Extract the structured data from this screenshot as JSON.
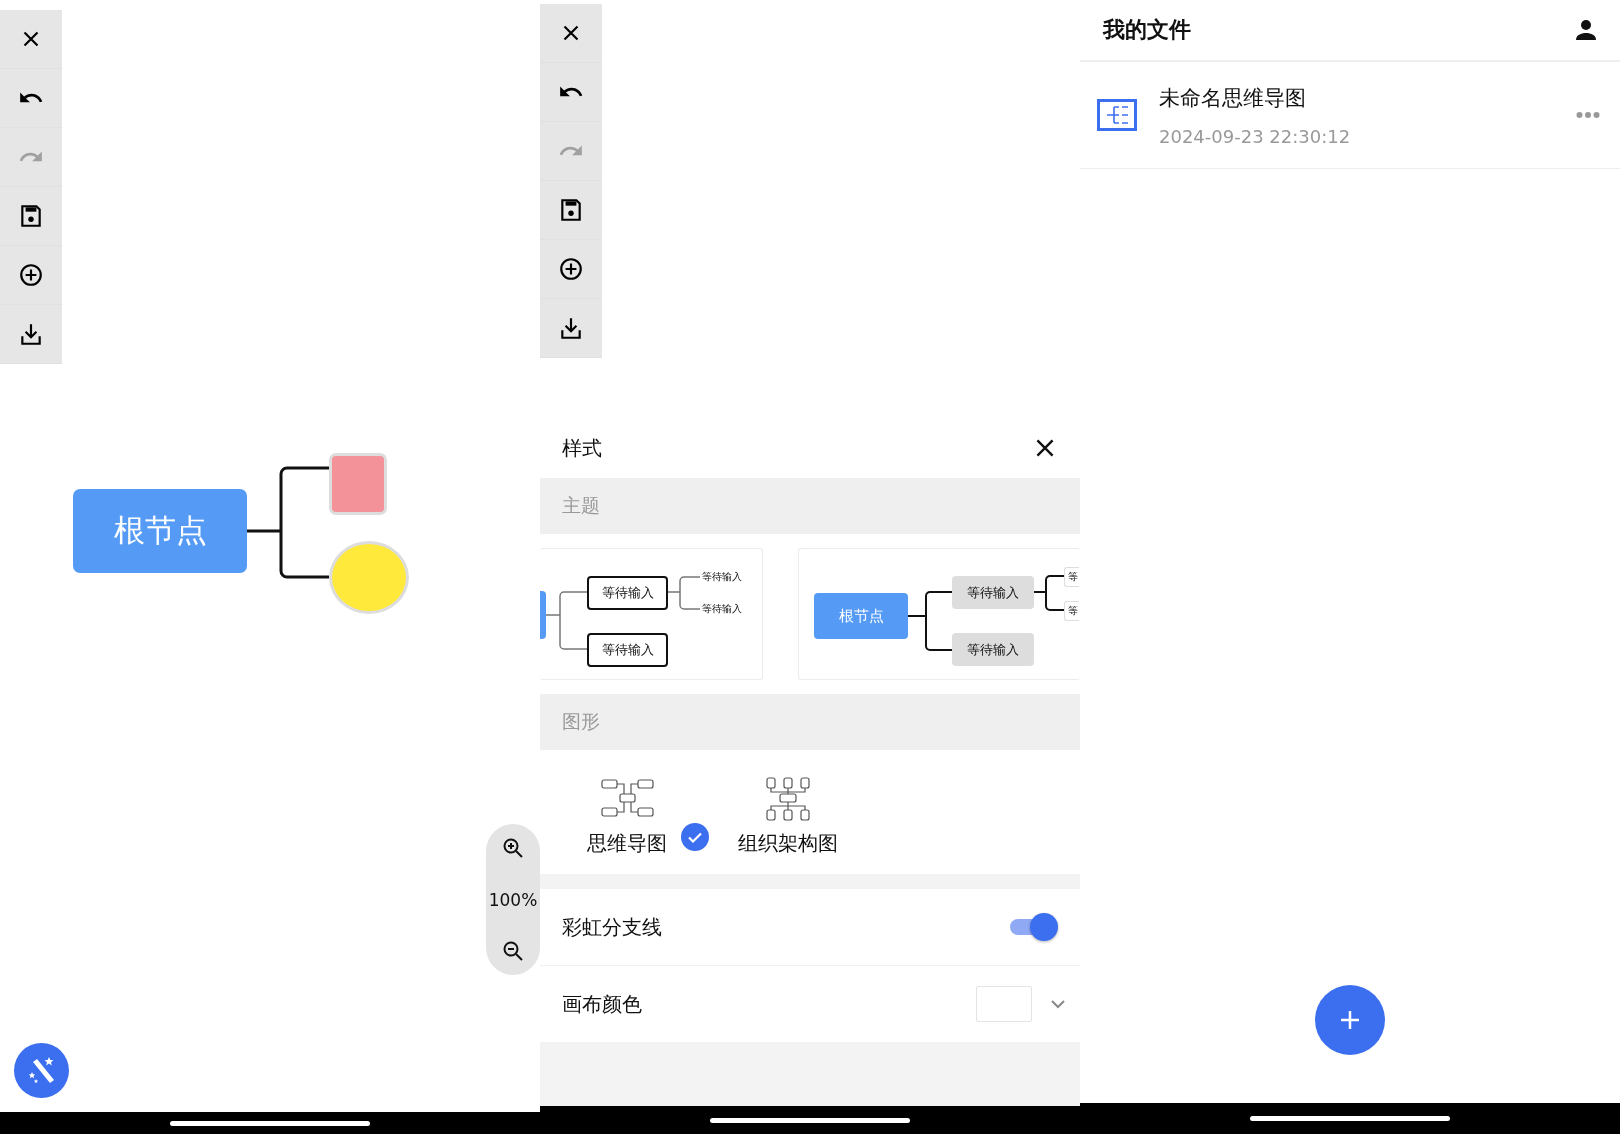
{
  "editor": {
    "toolbar": [
      {
        "kind": "close",
        "disabled": false
      },
      {
        "kind": "undo",
        "disabled": false
      },
      {
        "kind": "redo",
        "disabled": true
      },
      {
        "kind": "save",
        "disabled": false
      },
      {
        "kind": "add",
        "disabled": false
      },
      {
        "kind": "download",
        "disabled": false
      }
    ],
    "mind_map": {
      "root": "根节点",
      "children": [
        {
          "kind": "square",
          "color": "#f4929a"
        },
        {
          "kind": "circle",
          "color": "#ffe93a"
        }
      ]
    },
    "zoom": {
      "level_text": "100%"
    }
  },
  "style_editor": {
    "toolbar": [
      {
        "kind": "close",
        "disabled": false
      },
      {
        "kind": "undo",
        "disabled": false
      },
      {
        "kind": "redo",
        "disabled": true
      },
      {
        "kind": "save",
        "disabled": false
      },
      {
        "kind": "add",
        "disabled": false
      },
      {
        "kind": "download",
        "disabled": false
      }
    ],
    "panel": {
      "title": "样式",
      "theme_heading": "主题",
      "themes": [
        {
          "kind": "outlined",
          "branches": [
            "等待输入",
            "等待输入"
          ],
          "leaves": [
            "等待输入",
            "等待输入"
          ]
        },
        {
          "kind": "filled",
          "root": "根节点",
          "branches": [
            "等待输入",
            "等待输入"
          ],
          "leaves": [
            "等",
            "等"
          ]
        }
      ],
      "shape_heading": "图形",
      "layouts": [
        {
          "kind": "mind-map",
          "label": "思维导图",
          "selected": true
        },
        {
          "kind": "org-chart",
          "label": "组织架构图",
          "selected": false
        }
      ],
      "rainbow_branches": {
        "label": "彩虹分支线",
        "on": true
      },
      "canvas_color": {
        "label": "画布颜色"
      }
    }
  },
  "files": {
    "title": "我的文件",
    "items": [
      {
        "name": "未命名思维导图",
        "modified": "2024-09-23 22:30:12"
      }
    ]
  }
}
